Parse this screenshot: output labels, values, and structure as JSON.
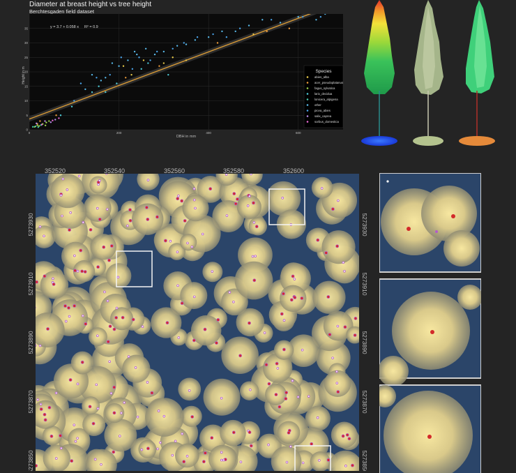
{
  "chart_data": {
    "type": "scatter",
    "title": "Diameter at breast height vs tree height",
    "subtitle": "Berchtesgaden field dataset",
    "xlabel": "DBH in mm",
    "ylabel": "Height in m",
    "xlim": [
      0,
      700
    ],
    "ylim": [
      0,
      40
    ],
    "xticks": [
      "0",
      "200",
      "400",
      "600"
    ],
    "yticks": [
      "0",
      "5",
      "10",
      "15",
      "20",
      "25",
      "30",
      "35"
    ],
    "equation": "y = 3.7 + 0.058 x",
    "r2": "R² = 0.9",
    "fit": {
      "intercept": 3.7,
      "slope": 0.058
    },
    "legend_title": "Species",
    "legend_position": "bottom-right",
    "background": "#0b0b0b",
    "series": [
      {
        "name": "abies_alba",
        "color": "#e8c94a",
        "points": [
          [
            210,
            22
          ],
          [
            228,
            19
          ],
          [
            255,
            24
          ],
          [
            300,
            23
          ],
          [
            320,
            25
          ],
          [
            350,
            24
          ],
          [
            500,
            33
          ]
        ]
      },
      {
        "name": "acer_pseudoplatanus",
        "color": "#ea9a3a",
        "points": [
          [
            18,
            2
          ],
          [
            24,
            3
          ],
          [
            60,
            5
          ],
          [
            215,
            18
          ],
          [
            290,
            22
          ],
          [
            420,
            30
          ],
          [
            530,
            34
          ],
          [
            580,
            35
          ]
        ]
      },
      {
        "name": "fagus_sylvatica",
        "color": "#9bd24a",
        "points": [
          [
            12,
            1
          ],
          [
            18,
            1.5
          ],
          [
            22,
            1.3
          ],
          [
            30,
            2
          ],
          [
            38,
            2.5
          ],
          [
            44,
            3
          ],
          [
            36,
            1.5
          ]
        ]
      },
      {
        "name": "larix_decidua",
        "color": "#4ec9d6",
        "points": [
          [
            70,
            5
          ],
          [
            95,
            8
          ],
          [
            140,
            13
          ],
          [
            155,
            15
          ],
          [
            170,
            13
          ],
          [
            195,
            16
          ],
          [
            250,
            21
          ],
          [
            265,
            23
          ],
          [
            310,
            19
          ]
        ]
      },
      {
        "name": "lonicera_alpigena",
        "color": "#45c3a8",
        "points": [
          [
            8,
            1
          ],
          [
            14,
            1.2
          ],
          [
            20,
            0.9
          ],
          [
            26,
            1.6
          ]
        ]
      },
      {
        "name": "other",
        "color": "#58b8e8",
        "points": [
          [
            125,
            14
          ],
          [
            140,
            19
          ],
          [
            160,
            17
          ],
          [
            170,
            18
          ],
          [
            185,
            23
          ],
          [
            200,
            22
          ],
          [
            220,
            24
          ],
          [
            235,
            27
          ],
          [
            240,
            26
          ],
          [
            260,
            28
          ],
          [
            280,
            26
          ],
          [
            300,
            27
          ],
          [
            330,
            29
          ],
          [
            350,
            29.5
          ],
          [
            370,
            31
          ],
          [
            400,
            32
          ],
          [
            430,
            34
          ],
          [
            460,
            34
          ],
          [
            490,
            36
          ],
          [
            520,
            38
          ],
          [
            560,
            37
          ],
          [
            600,
            39
          ],
          [
            640,
            38
          ],
          [
            660,
            40
          ]
        ]
      },
      {
        "name": "picea_abies",
        "color": "#4aa3e8",
        "points": [
          [
            100,
            10
          ],
          [
            115,
            16
          ],
          [
            150,
            18
          ],
          [
            180,
            19
          ],
          [
            205,
            25
          ],
          [
            230,
            21
          ],
          [
            245,
            25
          ],
          [
            270,
            24
          ],
          [
            285,
            27
          ],
          [
            320,
            28
          ],
          [
            345,
            30
          ],
          [
            375,
            32
          ],
          [
            410,
            33
          ],
          [
            440,
            32
          ],
          [
            470,
            35
          ],
          [
            540,
            38
          ],
          [
            610,
            39
          ],
          [
            650,
            39
          ]
        ]
      },
      {
        "name": "salix_caprea",
        "color": "#b98ae8",
        "points": [
          [
            16,
            2.2
          ],
          [
            35,
            3
          ],
          [
            48,
            2.6
          ],
          [
            58,
            3.5
          ]
        ]
      },
      {
        "name": "sorbus_domestica",
        "color": "#e86ad2",
        "points": [
          [
            28,
            1.8
          ],
          [
            52,
            3.2
          ],
          [
            66,
            4
          ]
        ]
      }
    ]
  },
  "map": {
    "x_ticks": [
      "352520",
      "352540",
      "352560",
      "352580",
      "352600"
    ],
    "y_ticks": [
      "5273930",
      "5273910",
      "5273890",
      "5273870",
      "5273850"
    ]
  },
  "colors": {
    "canopy_high": "#f7e7a0",
    "canopy_low": "#8f8b72",
    "ground": "#2b4569",
    "tree_top_marker": "#d22a2a",
    "tree_ring": "#b25cc9"
  }
}
